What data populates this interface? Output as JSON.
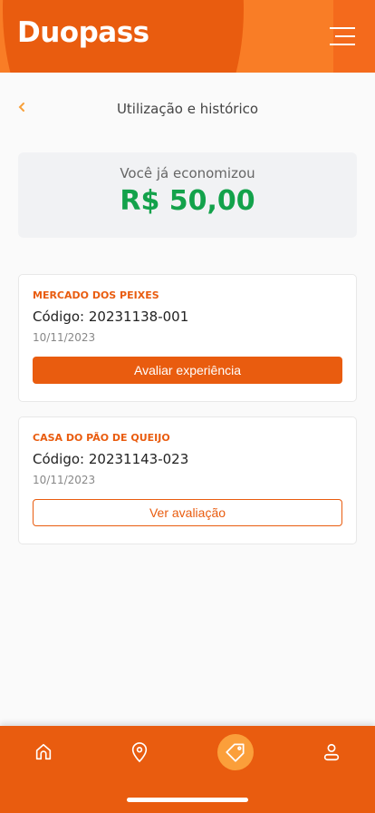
{
  "header": {
    "logo": "Duopass",
    "menu_icon": "hamburger-icon"
  },
  "page": {
    "title": "Utilização e histórico",
    "back_icon": "chevron-left-icon"
  },
  "savings": {
    "label": "Você já economizou",
    "value": "R$ 50,00"
  },
  "history": [
    {
      "store": "MERCADO DOS PEIXES",
      "code": "Código: 20231138-001",
      "date": "10/11/2023",
      "action": "Avaliar experiência"
    },
    {
      "store": "CASA DO PÃO DE QUEIJO",
      "code": "Código: 20231143-023",
      "date": "10/11/2023",
      "action": "Ver avaliação"
    }
  ],
  "nav": {
    "items": [
      "home-icon",
      "map-pin-icon",
      "tag-icon",
      "user-icon"
    ],
    "active": "tag-icon"
  },
  "colors": {
    "brand": "#e95c0f",
    "accent": "#fb9f3a",
    "success": "#13a24b"
  }
}
